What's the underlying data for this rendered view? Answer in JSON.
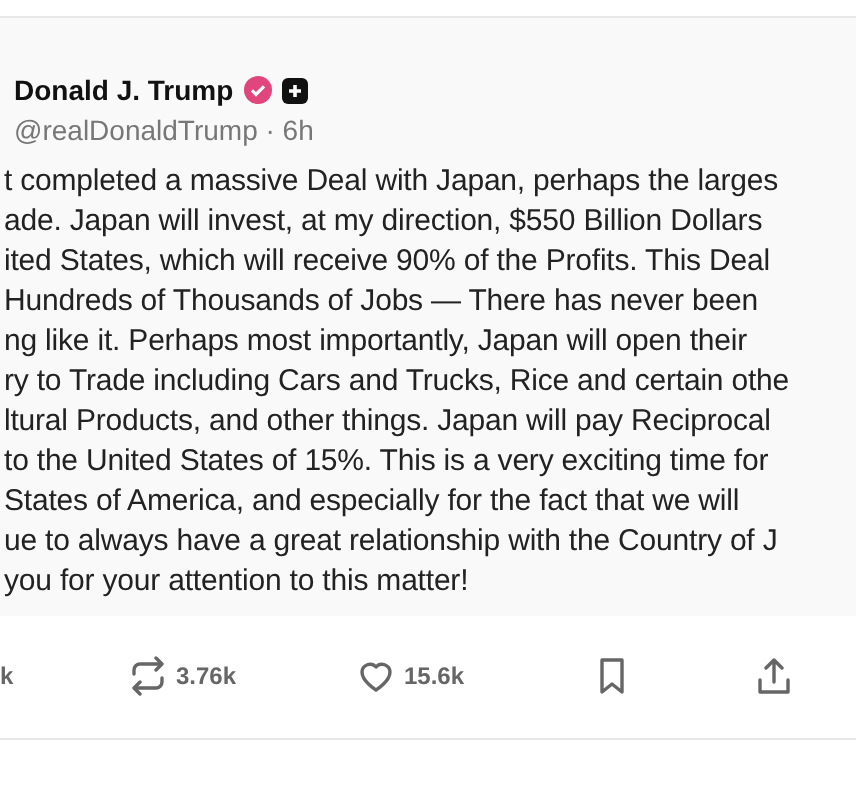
{
  "post": {
    "author": "Donald J. Trump",
    "verified": true,
    "handle": "@realDonaldTrump · 6h",
    "lines": [
      "t completed a massive Deal with Japan, perhaps the larges",
      "ade. Japan will invest, at my direction, $550 Billion Dollars",
      "ited States, which will receive 90% of the Profits. This Deal",
      "Hundreds of Thousands of Jobs — There has never been",
      "ng like it. Perhaps most importantly, Japan will open their",
      "ry to Trade including Cars and Trucks, Rice and certain othe",
      "ltural Products, and other things. Japan will pay Reciprocal",
      "to the United States of 15%. This is a very exciting time for",
      "States of America, and especially for the fact that we will",
      "ue to always have a great relationship with the Country of J",
      "you for your attention to this matter!"
    ]
  },
  "actions": [
    {
      "kind": "reply",
      "count": "k"
    },
    {
      "kind": "repost",
      "count": "3.76k"
    },
    {
      "kind": "like",
      "count": "15.6k"
    },
    {
      "kind": "bookmark"
    },
    {
      "kind": "share"
    }
  ]
}
